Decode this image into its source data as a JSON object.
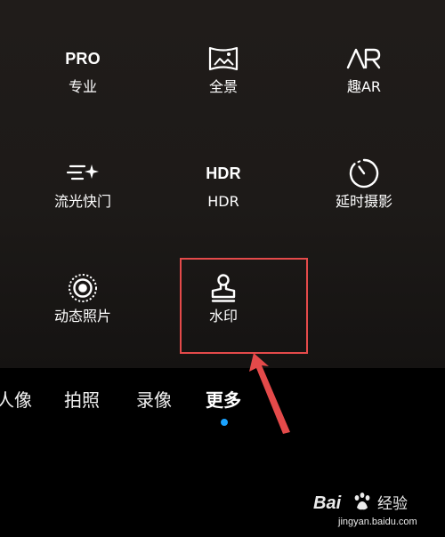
{
  "modes": [
    {
      "label": "专业",
      "icon": "pro-text-icon",
      "icon_text": "PRO"
    },
    {
      "label": "全景",
      "icon": "panorama-icon"
    },
    {
      "label": "趣AR",
      "icon": "ar-icon"
    },
    {
      "label": "流光快门",
      "icon": "light-painting-icon"
    },
    {
      "label": "HDR",
      "icon": "hdr-text-icon",
      "icon_text": "HDR"
    },
    {
      "label": "延时摄影",
      "icon": "time-lapse-icon"
    },
    {
      "label": "动态照片",
      "icon": "moving-picture-icon"
    },
    {
      "label": "水印",
      "icon": "watermark-stamp-icon"
    }
  ],
  "bottom_tabs": [
    {
      "label": "人像"
    },
    {
      "label": "拍照"
    },
    {
      "label": "录像"
    },
    {
      "label": "更多",
      "active": true
    }
  ],
  "annotation": {
    "highlight_color": "#e44a4a",
    "arrow_color": "#e44a4a"
  },
  "watermark": {
    "brand": "Bai",
    "brand_suffix": "经验",
    "url": "jingyan.baidu.com"
  },
  "colors": {
    "active_dot": "#1aa3ff",
    "panel_bg": "#1e1a18",
    "bottom_bg": "#000000"
  }
}
